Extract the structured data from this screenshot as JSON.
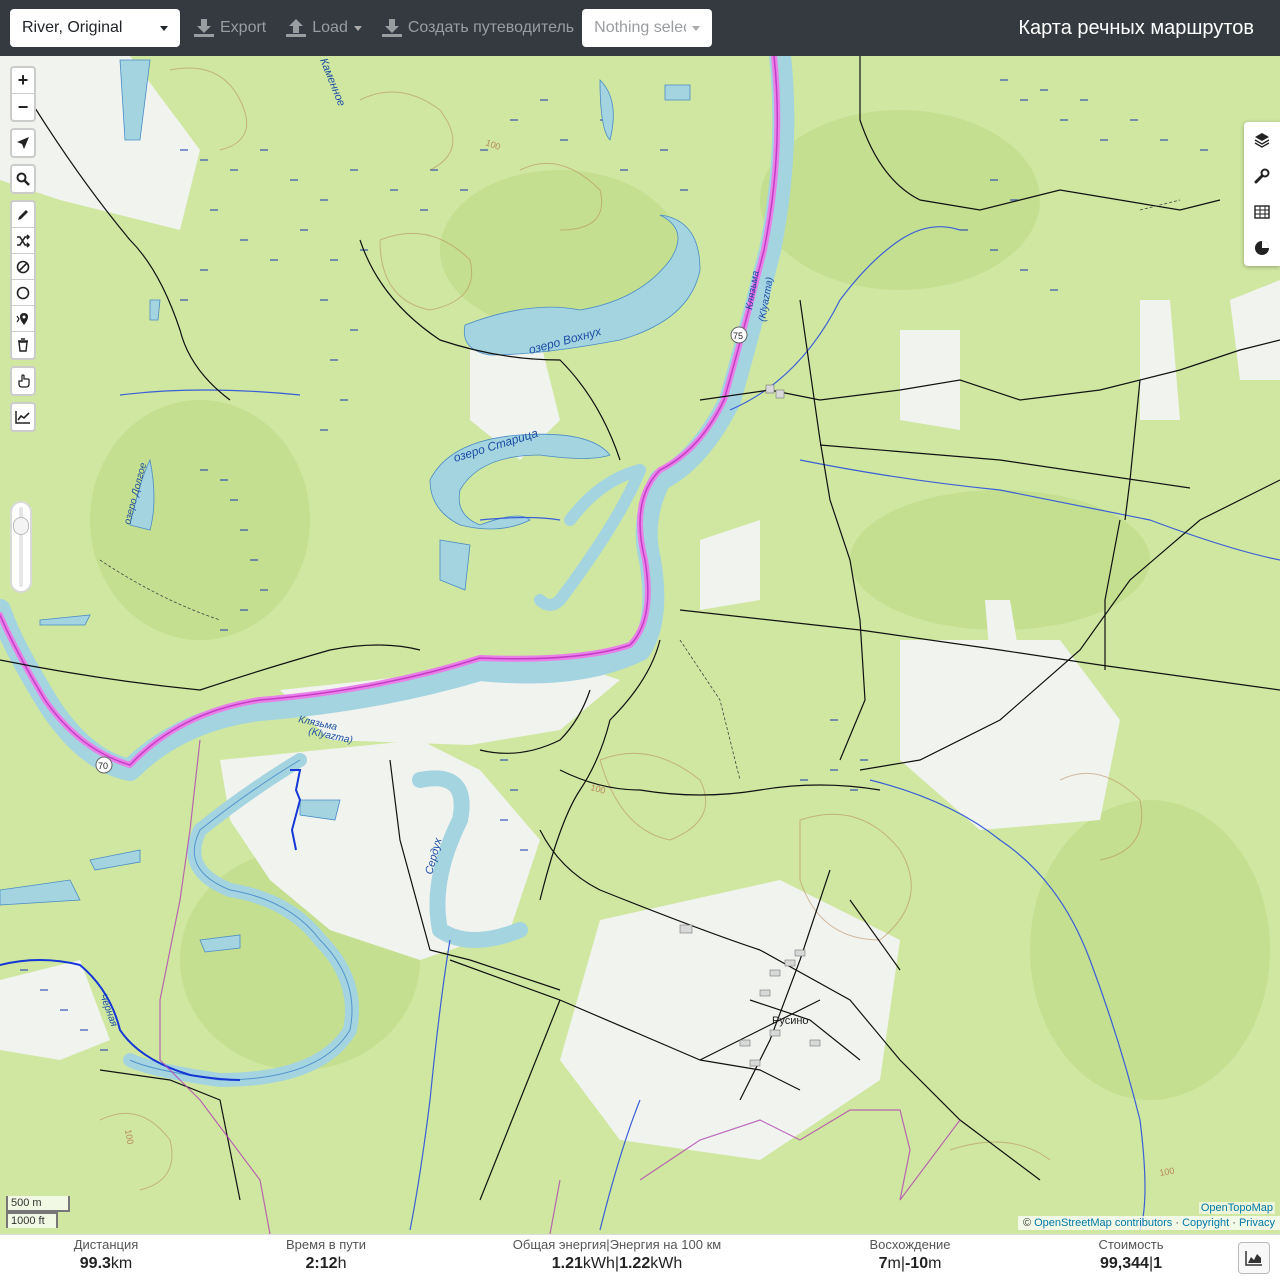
{
  "navbar": {
    "profile": "River, Original",
    "export_label": "Export",
    "load_label": "Load",
    "guide_label": "Создать путеводитель",
    "nothing_selected": "Nothing selected",
    "title": "Карта речных маршрутов"
  },
  "map_labels": {
    "lake_vokhnukh": "озеро Вохнух",
    "lake_staritsa": "озеро Старица",
    "lake_dolgoe": "озеро Долгое",
    "kamennoe": "Каменное",
    "klyazma_upper": "Клязьма",
    "klyazma_upper_lat": "(Klyazma)",
    "klyazma_lower": "Клязьма",
    "klyazma_lower_lat": "(Klyazma)",
    "serdukh": "Сердух",
    "chernaya": "Черная",
    "rusino": "Русино",
    "km_75": "75",
    "km_70": "70",
    "contour_100": "100"
  },
  "scale": {
    "metric": "500 m",
    "imperial": "1000 ft"
  },
  "attribution": {
    "opentopomap": "OpenTopoMap",
    "copy": "©",
    "osm": "OpenStreetMap contributors",
    "sep1": " · ",
    "copyright": "Copyright",
    "sep2": " · ",
    "privacy": "Privacy"
  },
  "footer": {
    "distance_label": "Дистанция",
    "distance_value": "99.3",
    "distance_unit": "km",
    "time_label": "Время в пути",
    "time_value": "2:12",
    "time_unit": "h",
    "energy_label": "Общая энергия|Энергия на 100 км",
    "energy_value_1": "1.21",
    "energy_unit_1": "kWh",
    "energy_sep": "|",
    "energy_value_2": "1.22",
    "energy_unit_2": "kWh",
    "ascent_label": "Восхождение",
    "ascent_up": "7",
    "ascent_up_unit": "m",
    "ascent_sep": "|",
    "ascent_down": "-10",
    "ascent_down_unit": "m",
    "cost_label": "Стоимость",
    "cost_value": "99,344",
    "cost_sep": "|",
    "cost_count": "1"
  },
  "colors": {
    "navbar": "#343a40",
    "forest": "#cfe7a0",
    "water": "#a4d4e0",
    "route": "#d65fd6",
    "open": "#f2f4ee"
  }
}
